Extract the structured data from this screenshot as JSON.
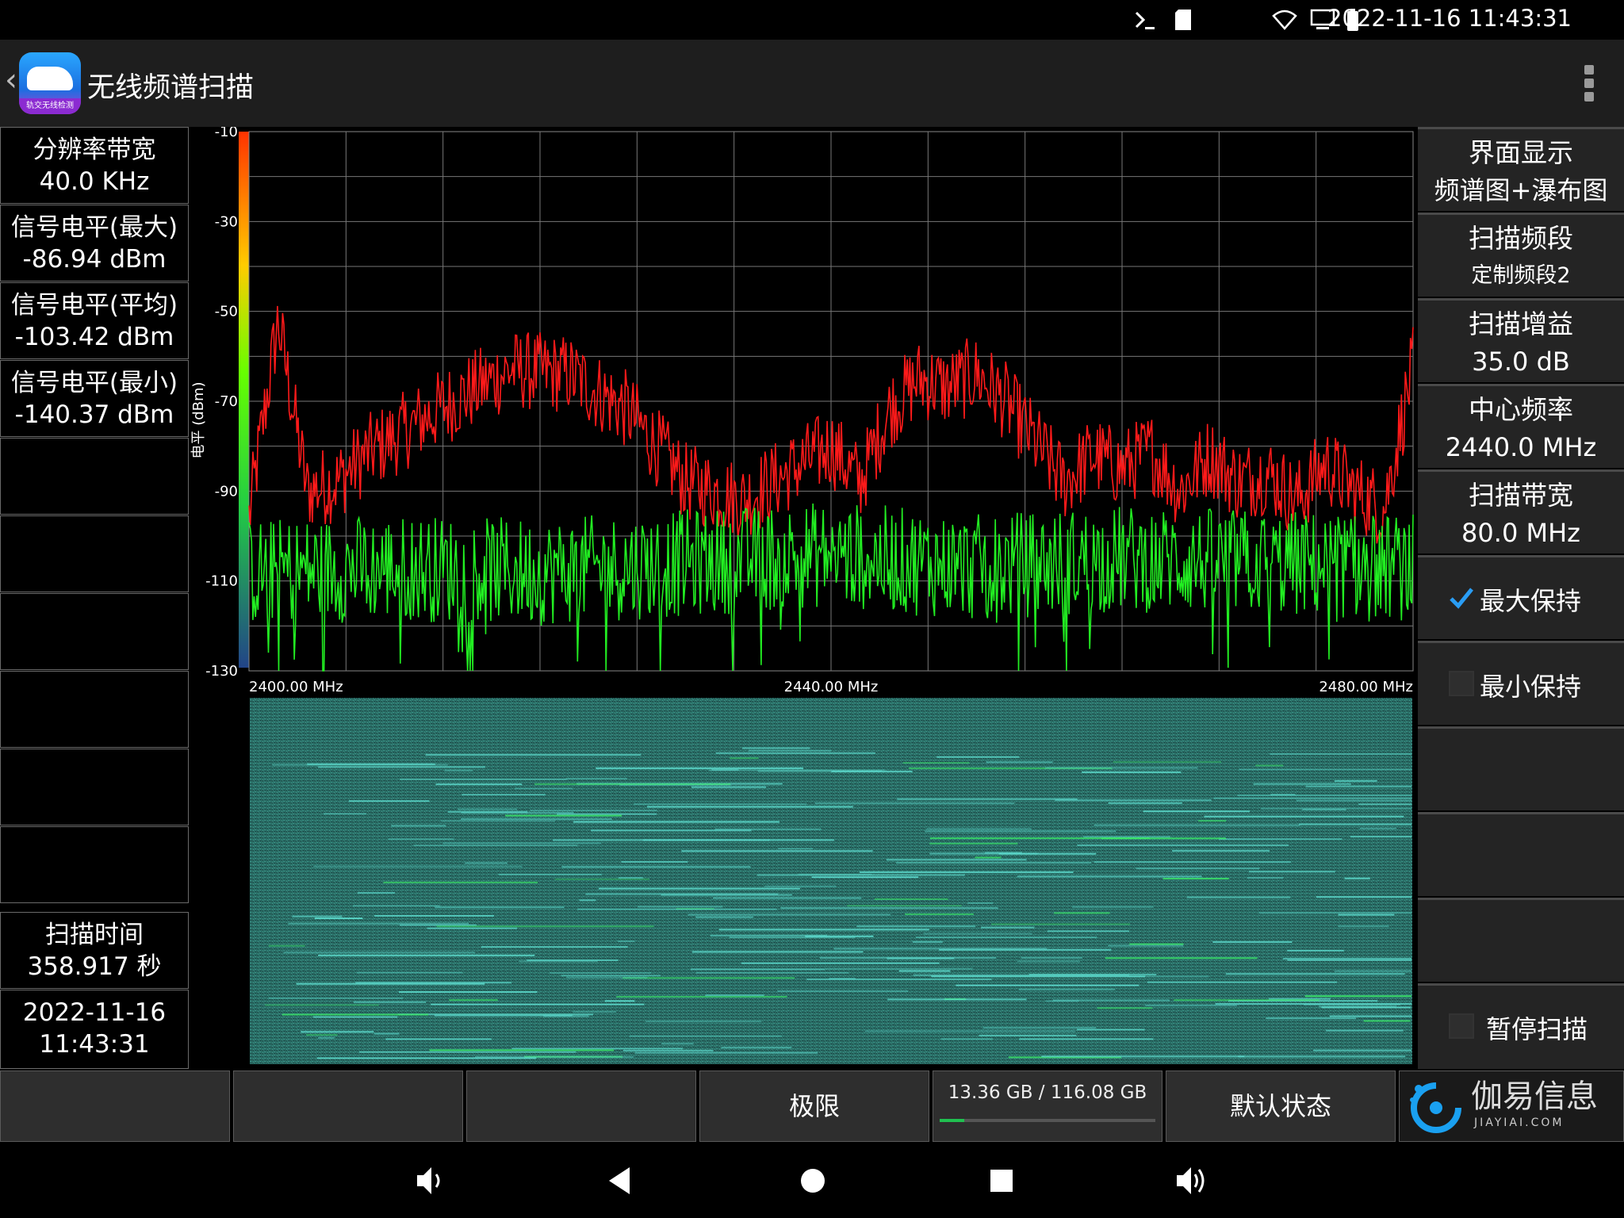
{
  "status_bar": {
    "datetime": "2022-11-16 11:43:31"
  },
  "app_bar": {
    "title": "无线频谱扫描",
    "logo_text": "轨交无线检测"
  },
  "left_panel": {
    "items": [
      {
        "label": "分辨率带宽",
        "value": "40.0 KHz"
      },
      {
        "label": "信号电平(最大)",
        "value": "-86.94 dBm"
      },
      {
        "label": "信号电平(平均)",
        "value": "-103.42 dBm"
      },
      {
        "label": "信号电平(最小)",
        "value": "-140.37 dBm"
      }
    ],
    "scan_time_label": "扫描时间",
    "scan_time_value": "358.917 秒",
    "date": "2022-11-16",
    "time": "11:43:31"
  },
  "right_panel": {
    "display_label": "界面显示",
    "display_value": "频谱图+瀑布图",
    "band_label": "扫描频段",
    "band_value": "定制频段2",
    "gain_label": "扫描增益",
    "gain_value": "35.0 dB",
    "center_label": "中心频率",
    "center_value": "2440.0 MHz",
    "span_label": "扫描带宽",
    "span_value": "80.0 MHz",
    "max_hold_label": "最大保持",
    "max_hold_checked": true,
    "min_hold_label": "最小保持",
    "min_hold_checked": false,
    "pause_label": "暂停扫描",
    "pause_checked": false
  },
  "bottom_bar": {
    "limit_label": "极限",
    "storage_text": "13.36 GB / 116.08 GB",
    "storage_used_fraction": 0.115,
    "default_label": "默认状态",
    "brand_name": "伽易信息",
    "brand_url": "JIAYIAI.COM"
  },
  "chart_data": {
    "type": "line",
    "ylabel": "电平 (dBm)",
    "ylim": [
      -130,
      -10
    ],
    "yticks": [
      "-10",
      "-30",
      "-50",
      "-70",
      "-90",
      "-110",
      "-130"
    ],
    "xlim": [
      2400,
      2480
    ],
    "xtick_labels": [
      "2400.00 MHz",
      "2440.00 MHz",
      "2480.00 MHz"
    ],
    "grid": true,
    "series": [
      {
        "color": "#ff1a1a",
        "x": [
          2400,
          2402,
          2404,
          2406,
          2408,
          2410,
          2414,
          2418,
          2422,
          2426,
          2430,
          2434,
          2438,
          2440,
          2442,
          2444,
          2446,
          2448,
          2450,
          2452,
          2456,
          2458,
          2460,
          2462,
          2464,
          2466,
          2468,
          2470,
          2472,
          2474,
          2476,
          2478,
          2480
        ],
        "values": [
          -96,
          -52,
          -90,
          -88,
          -82,
          -78,
          -70,
          -63,
          -64,
          -72,
          -88,
          -92,
          -84,
          -80,
          -88,
          -72,
          -65,
          -67,
          -64,
          -70,
          -88,
          -82,
          -85,
          -81,
          -90,
          -82,
          -88,
          -86,
          -92,
          -84,
          -90,
          -94,
          -62
        ]
      },
      {
        "color": "#22ee22",
        "x": [
          2400,
          2410,
          2420,
          2430,
          2440,
          2450,
          2460,
          2470,
          2480
        ],
        "values": [
          -108,
          -107,
          -108,
          -106,
          -104,
          -107,
          -105,
          -106,
          -107
        ]
      }
    ]
  }
}
